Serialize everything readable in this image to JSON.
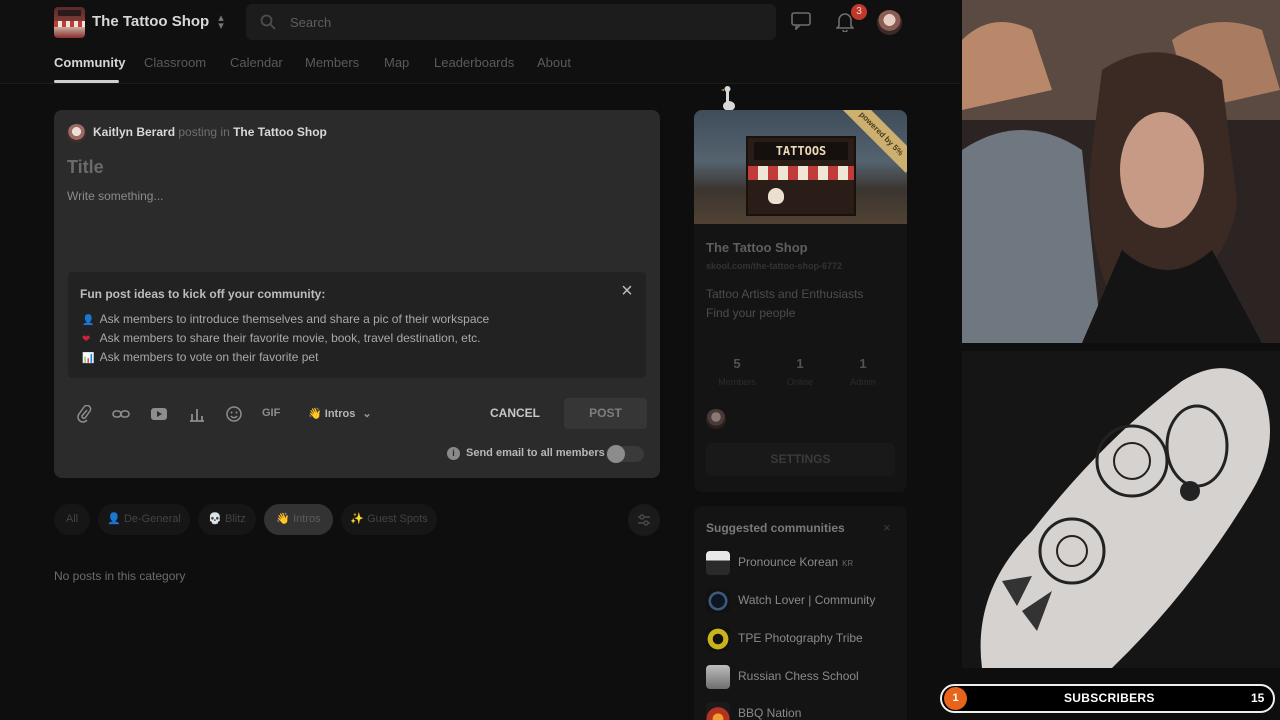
{
  "app": {
    "name": "The Tattoo Shop",
    "search_placeholder": "Search",
    "notification_count": "3"
  },
  "nav": {
    "tabs": [
      "Community",
      "Classroom",
      "Calendar",
      "Members",
      "Map",
      "Leaderboards",
      "About"
    ],
    "active": "Community"
  },
  "composer": {
    "author": "Kaitlyn Berard",
    "posting_in_text": "posting in",
    "group": "The Tattoo Shop",
    "title_placeholder": "Title",
    "body_placeholder": "Write something...",
    "ideas_title": "Fun post ideas to kick off your community:",
    "ideas": [
      {
        "icon": "person-icon",
        "glyph": "👤",
        "text": "Ask members to introduce themselves and share a pic of their workspace"
      },
      {
        "icon": "heart-icon",
        "glyph": "❤",
        "text": "Ask members to share their favorite movie, book, travel destination, etc."
      },
      {
        "icon": "bar-chart-icon",
        "glyph": "📊",
        "text": "Ask members to vote on their favorite pet"
      }
    ],
    "gif_label": "GIF",
    "category": "Intros",
    "category_emoji": "👋",
    "cancel_label": "CANCEL",
    "post_label": "POST",
    "email_label": "Send email to all members",
    "email_toggle_on": false
  },
  "filters": {
    "chips": [
      {
        "label": "All",
        "emoji": ""
      },
      {
        "label": "De-General",
        "emoji": "👤"
      },
      {
        "label": "Blitz",
        "emoji": "💀"
      },
      {
        "label": "Intros",
        "emoji": "👋"
      },
      {
        "label": "Guest Spots",
        "emoji": "✨"
      }
    ],
    "active": "Intros",
    "empty_message": "No posts in this category"
  },
  "group_card": {
    "banner_sign": "TATTOOS",
    "ribbon": "powered by 5%",
    "name": "The Tattoo Shop",
    "url": "skool.com/the-tattoo-shop-6772",
    "description_line1": "Tattoo Artists and Enthusiasts",
    "description_line2": "Find your people",
    "stats": [
      {
        "value": "5",
        "label": "Members"
      },
      {
        "value": "1",
        "label": "Online"
      },
      {
        "value": "1",
        "label": "Admin"
      }
    ],
    "settings_label": "SETTINGS"
  },
  "suggested": {
    "title": "Suggested communities",
    "close": "×",
    "items": [
      {
        "name": "Pronounce Korean",
        "flag": "KR",
        "color": "#d8d8d8"
      },
      {
        "name": "Watch Lover | Community",
        "flag": "",
        "color": "#1c2a3a"
      },
      {
        "name": "TPE Photography Tribe",
        "flag": "",
        "color": "#c9b31a"
      },
      {
        "name": "Russian Chess School",
        "flag": "",
        "color": "#9a9a9a"
      },
      {
        "name": "BBQ Nation",
        "flag": "",
        "color": "#b4331f"
      }
    ]
  },
  "stream_overlay": {
    "subscribers_label": "SUBSCRIBERS",
    "subscribers_value": "15",
    "goal_marker": "1"
  },
  "colors": {
    "background": "#0e0e0e",
    "card": "#2b2b2b",
    "notification": "#c0392b",
    "subscriber_accent": "#e8641b"
  }
}
